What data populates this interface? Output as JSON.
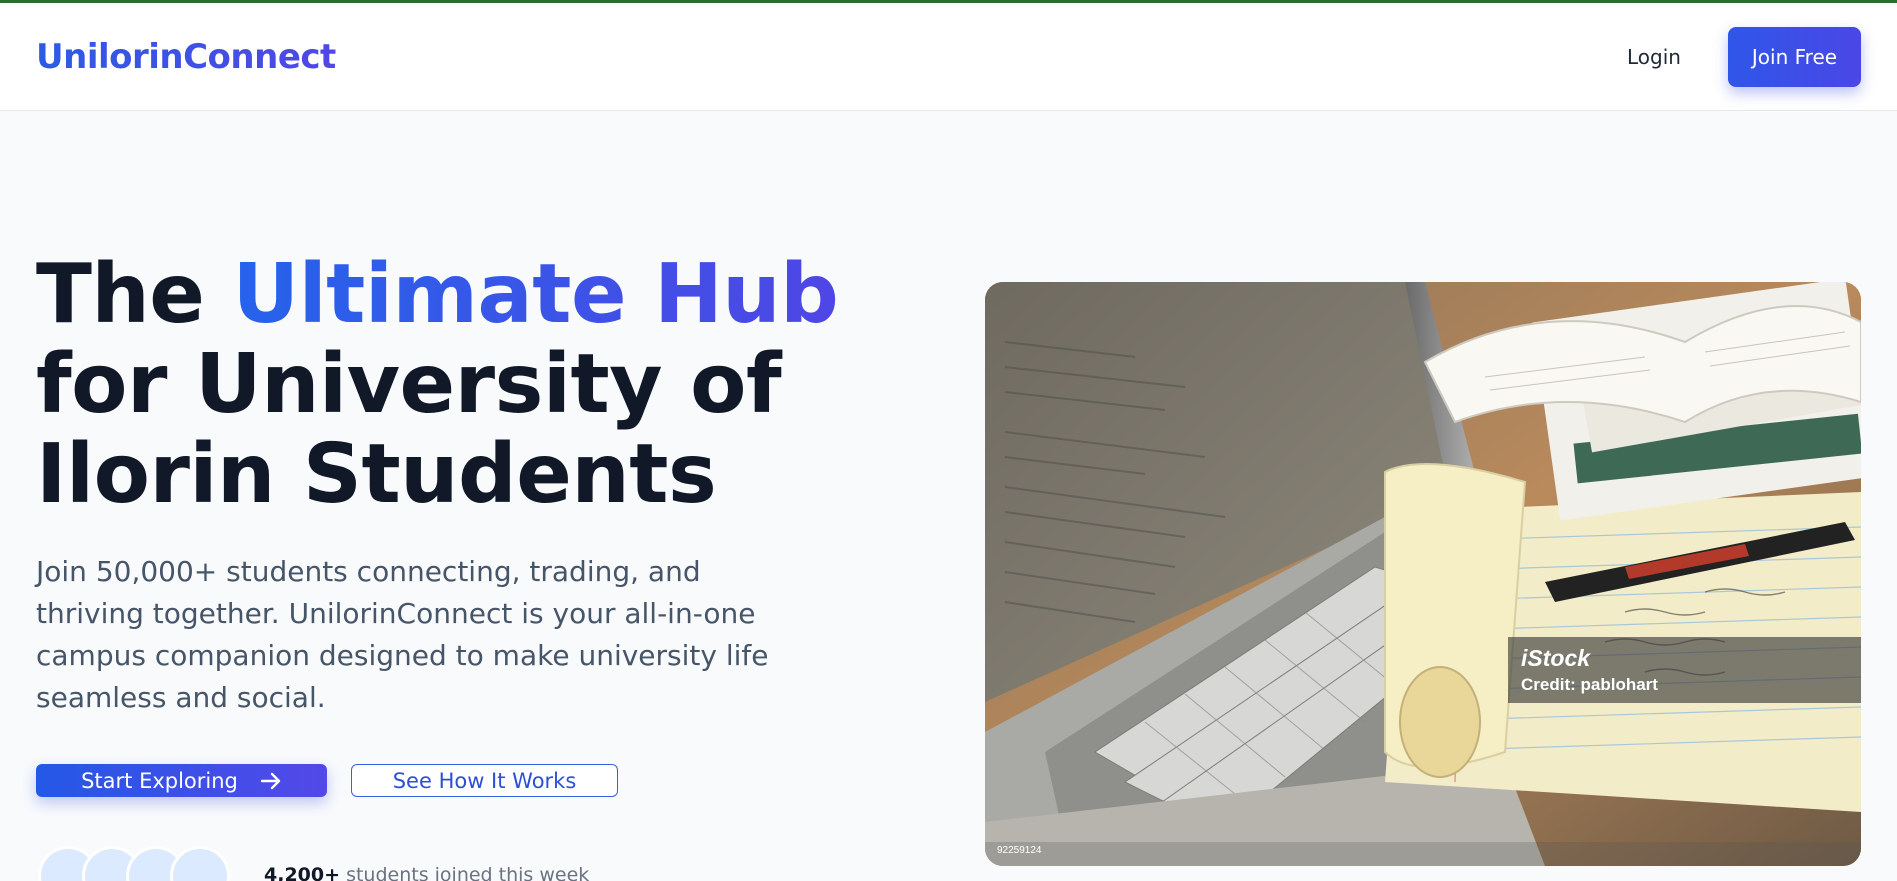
{
  "nav": {
    "logo": "UnilorinConnect",
    "login_label": "Login",
    "join_label": "Join Free"
  },
  "hero": {
    "title_part1": "The ",
    "title_accent": "Ultimate Hub",
    "title_part2": "for University of Ilorin Students",
    "description": "Join 50,000+ students connecting, trading, and thriving together. UnilorinConnect is your all-in-one campus companion designed to make university life seamless and social.",
    "primary_cta": "Start Exploring",
    "primary_cta_icon": "arrow-right-icon",
    "secondary_cta": "See How It Works",
    "social_proof_count": "4,200+",
    "social_proof_text": " students joined this week"
  },
  "image": {
    "watermark_brand": "iStock",
    "watermark_credit": "Credit: pablohart",
    "image_id": "92259124"
  },
  "colors": {
    "brand": "#3b4fe0",
    "accent_start": "#2563eb",
    "accent_end": "#4f46e5",
    "heading": "#111827",
    "body_text": "#475569",
    "background": "#f8fafc"
  }
}
